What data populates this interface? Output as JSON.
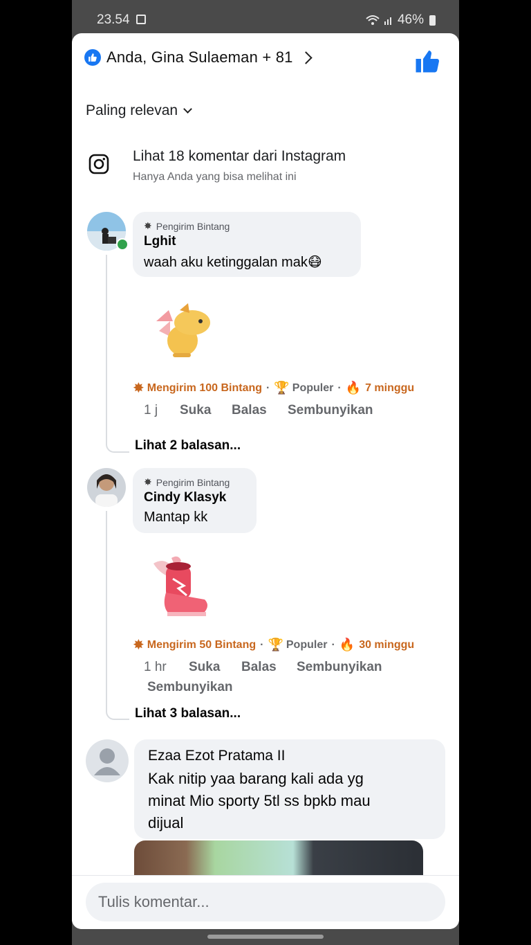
{
  "status_bar": {
    "time": "23.54",
    "battery": "46%"
  },
  "reactions": {
    "summary": "Anda, Gina Sulaeman + 81"
  },
  "sort": {
    "label": "Paling relevan"
  },
  "instagram": {
    "title": "Lihat 18 komentar dari Instagram",
    "subtitle": "Hanya Anda yang bisa melihat ini"
  },
  "comments": [
    {
      "badge": "Pengirim Bintang",
      "author": "Lghit",
      "text": "waah aku ketinggalan mak😷",
      "stars_sent": "Mengirim 100 Bintang",
      "popular": "Populer",
      "streak": "7 minggu",
      "time": "1 j",
      "like": "Suka",
      "reply": "Balas",
      "hide": "Sembunyikan",
      "replies": "Lihat 2 balasan..."
    },
    {
      "badge": "Pengirim Bintang",
      "author": "Cindy Klasyk",
      "text": "Mantap kk",
      "stars_sent": "Mengirim 50 Bintang",
      "popular": "Populer",
      "streak": "30 minggu",
      "time": "1 hr",
      "like": "Suka",
      "reply": "Balas",
      "hide": "Sembunyikan",
      "hide2": "Sembunyikan",
      "replies": "Lihat 3 balasan..."
    },
    {
      "author": "Ezaa Ezot Pratama II",
      "text_lines": [
        "Kak nitip yaa barang kali ada yg",
        "minat Mio sporty 5tl ss bpkb mau",
        "dijual"
      ]
    }
  ],
  "composer": {
    "placeholder": "Tulis komentar..."
  },
  "colors": {
    "accent": "#1877f2",
    "star_orange": "#c8671e",
    "bubble": "#f0f2f5"
  }
}
